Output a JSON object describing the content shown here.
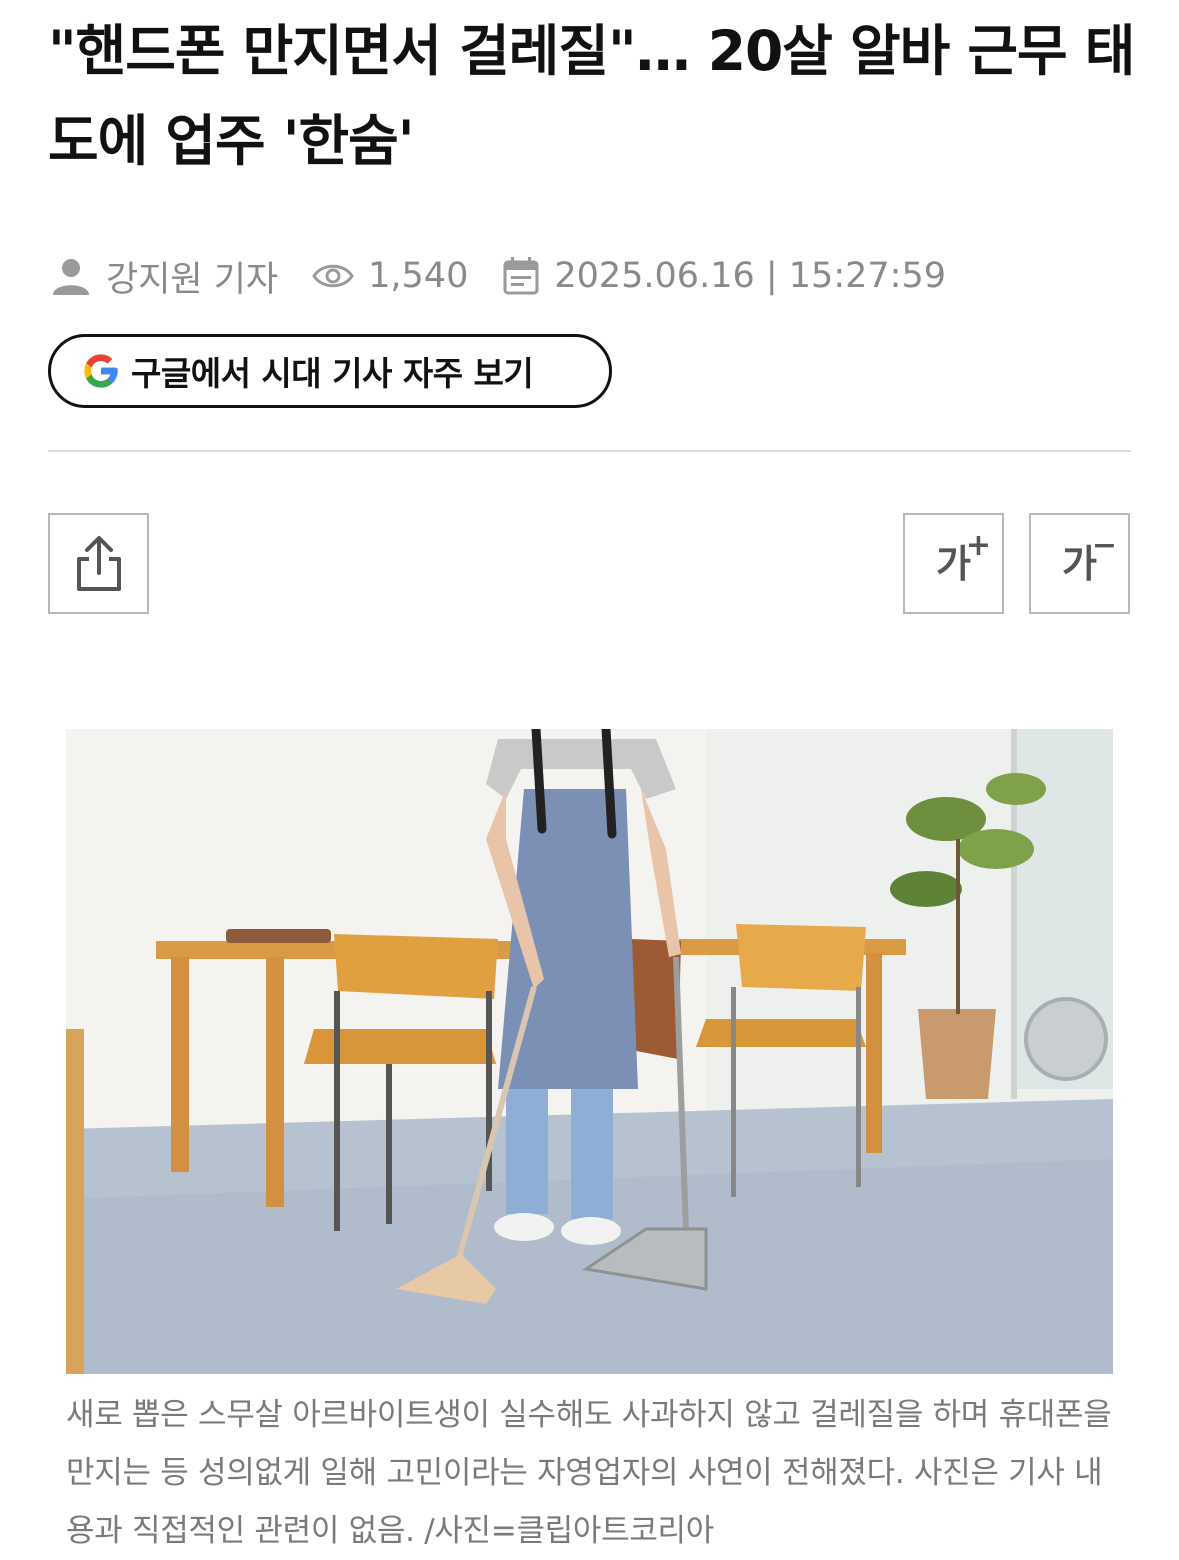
{
  "article": {
    "headline": "\"핸드폰 만지면서 걸레질\"… 20살 알바 근무 태도에 업주 '한숨'",
    "author": "강지원 기자",
    "views": "1,540",
    "date": "2025.06.16 | 15:27:59",
    "google_follow_label": "구글에서 시대 기사 자주 보기",
    "caption": "새로 뽑은 스무살 아르바이트생이 실수해도 사과하지 않고 걸레질을 하며 휴대폰을 만지는 등 성의없게 일해 고민이라는 자영업자의 사연이 전해졌다. 사진은 기사 내용과 직접적인 관련이 없음. /사진=클립아트코리아"
  },
  "toolbar": {
    "font_up_glyph": "가",
    "font_up_sign": "+",
    "font_down_glyph": "가",
    "font_down_sign": "−"
  },
  "icons": {
    "author": "person-icon",
    "views": "eye-icon",
    "date": "calendar-icon",
    "google": "google-g-icon",
    "share": "share-icon"
  },
  "colors": {
    "meta_text": "#8a8a8a",
    "caption_text": "#7a7a7a",
    "google_blue": "#4285F4",
    "google_red": "#EA4335",
    "google_yellow": "#FBBC05",
    "google_green": "#34A853"
  }
}
